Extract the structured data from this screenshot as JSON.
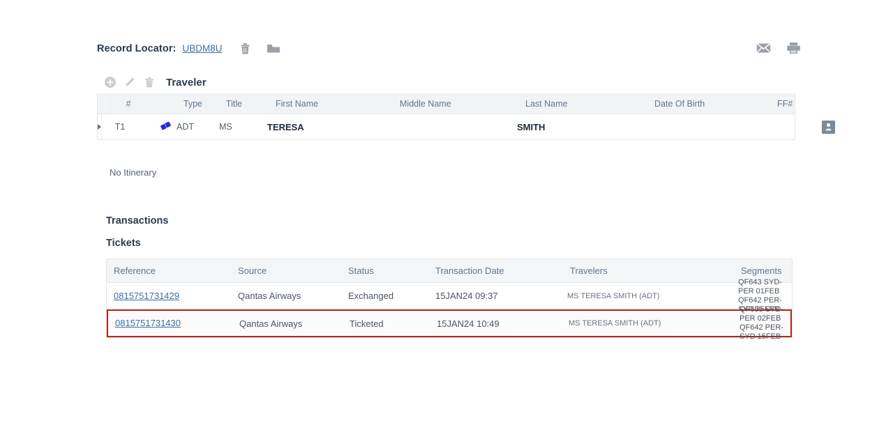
{
  "record": {
    "label": "Record Locator:",
    "value": "UBDM8U",
    "delete_icon": "trash-icon",
    "folder_icon": "folder-icon"
  },
  "header_actions": {
    "email_icon": "envelope-icon",
    "print_icon": "printer-icon"
  },
  "traveler_section": {
    "title": "Traveler",
    "toolbar": {
      "add_label": "add-icon",
      "edit_label": "edit-pencil-icon",
      "delete_label": "trash-icon"
    },
    "columns": [
      "#",
      "Type",
      "Title",
      "First Name",
      "Middle Name",
      "Last Name",
      "Date Of Birth",
      "FF#"
    ],
    "rows": [
      {
        "num": "T1",
        "type": "ADT",
        "title": "MS",
        "first_name": "TERESA",
        "middle_name": "",
        "last_name": "SMITH",
        "dob": "",
        "ff": "",
        "type_icon": "ticket-icon",
        "profile_icon": "person-icon"
      }
    ]
  },
  "itinerary": {
    "empty_text": "No Itinerary"
  },
  "transactions": {
    "title": "Transactions",
    "tickets": {
      "title": "Tickets",
      "columns": [
        "Reference",
        "Source",
        "Status",
        "Transaction Date",
        "Travelers",
        "Segments"
      ],
      "rows": [
        {
          "reference": "0815751731429",
          "source": "Qantas Airways",
          "status": "Exchanged",
          "transaction_date": "15JAN24 09:37",
          "travelers": "MS TERESA SMITH (ADT)",
          "segments": [
            "QF643 SYD-PER 01FEB",
            "QF642 PER-SYD 15FEB"
          ],
          "highlighted": false
        },
        {
          "reference": "0815751731430",
          "source": "Qantas Airways",
          "status": "Ticketed",
          "transaction_date": "15JAN24 10:49",
          "travelers": "MS TERESA SMITH (ADT)",
          "segments": [
            "QF655 SYD-PER 02FEB",
            "QF642 PER-SYD 15FEB"
          ],
          "highlighted": true
        }
      ]
    }
  },
  "colors": {
    "link": "#3a6ea5",
    "header_text": "#5d7690",
    "highlight_border": "#b3261e",
    "ticket_icon": "#2a2ad8",
    "table_header_bg": "#f2f3f4"
  }
}
